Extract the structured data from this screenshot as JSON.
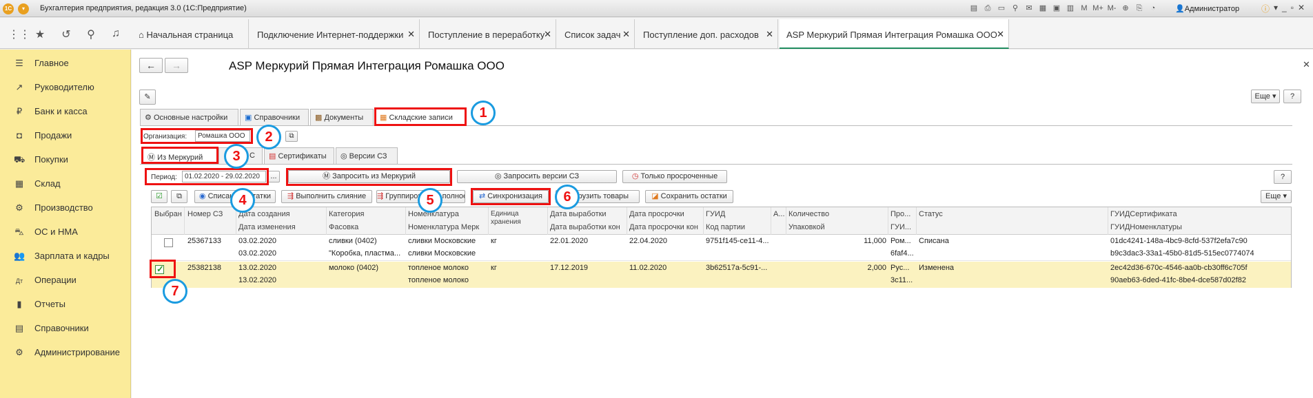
{
  "titlebar": {
    "logo": "1С",
    "title": "Бухгалтерия предприятия, редакция 3.0  (1С:Предприятие)",
    "icons": [
      "M",
      "M+",
      "M-"
    ],
    "user": "Администратор"
  },
  "tabs": [
    {
      "label": "Начальная страница",
      "home": true
    },
    {
      "label": "Подключение Интернет-поддержки",
      "closable": true
    },
    {
      "label": "Поступление в переработку",
      "closable": true
    },
    {
      "label": "Список задач",
      "closable": true
    },
    {
      "label": "Поступление доп. расходов",
      "closable": true
    },
    {
      "label": "ASP Меркурий Прямая Интеграция Ромашка ООО",
      "closable": true,
      "active": true
    }
  ],
  "sidebar": {
    "items": [
      {
        "label": "Главное",
        "icon": "menu-icon"
      },
      {
        "label": "Руководителю",
        "icon": "trend-icon"
      },
      {
        "label": "Банк и касса",
        "icon": "coin-icon"
      },
      {
        "label": "Продажи",
        "icon": "bag-icon"
      },
      {
        "label": "Покупки",
        "icon": "cart-icon"
      },
      {
        "label": "Склад",
        "icon": "warehouse-icon"
      },
      {
        "label": "Производство",
        "icon": "factory-icon"
      },
      {
        "label": "ОС и НМА",
        "icon": "truck-icon"
      },
      {
        "label": "Зарплата и кадры",
        "icon": "people-icon"
      },
      {
        "label": "Операции",
        "icon": "dt-kt-icon"
      },
      {
        "label": "Отчеты",
        "icon": "report-icon"
      },
      {
        "label": "Справочники",
        "icon": "book-icon"
      },
      {
        "label": "Администрирование",
        "icon": "gear-icon"
      }
    ]
  },
  "page": {
    "title": "ASP Меркурий Прямая Интеграция Ромашка ООО",
    "more_label": "Еще",
    "help_label": "?"
  },
  "top_tabs": [
    "Основные настройки",
    "Справочники",
    "Документы",
    "Складские записи"
  ],
  "org": {
    "label": "Организация:",
    "value": "Ромашка ООО"
  },
  "sub_tabs": [
    "Из Меркурий",
    "С",
    "Сертификаты",
    "Версии СЗ"
  ],
  "period": {
    "label": "Период:",
    "value": "01.02.2020 - 29.02.2020",
    "more": "..."
  },
  "buttons": {
    "request_mercury": "Запросить из Меркурий",
    "request_versions": "Запросить версии СЗ",
    "only_expired": "Только просроченные",
    "write_off": "Списание остатки",
    "merge": "Выполнить слияние",
    "group": "Группировка по полное",
    "sync": "Синхронизация",
    "load_goods": "Загрузить товары",
    "save_balances": "Сохранить остатки",
    "more": "Еще"
  },
  "callouts": [
    "1",
    "2",
    "3",
    "4",
    "5",
    "6",
    "7"
  ],
  "grid": {
    "headers_row1": [
      "Выбран",
      "Номер СЗ",
      "Дата создания",
      "Категория",
      "Номенклатура",
      "Единица хранения",
      "Дата выработки",
      "Дата просрочки",
      "ГУИД",
      "А...",
      "Количество",
      "Про...",
      "Статус",
      "ГУИДСертификата"
    ],
    "headers_row2": [
      "Дата изменения",
      "Фасовка",
      "Номенклатура Мерк",
      "Дата выработки кон",
      "Дата просрочки кон",
      "Код партии",
      "Упаковкой",
      "ГУИ...",
      "ГУИДНоменклатуры"
    ],
    "rows": [
      {
        "checked": false,
        "number": "25367133",
        "created": "03.02.2020",
        "changed": "03.02.2020",
        "category": "сливки (0402)",
        "packing": "\"Коробка, пластма...",
        "nomenclature": "сливки Московские",
        "nomenclature_m": "сливки Московские",
        "unit": "кг",
        "produced": "22.01.2020",
        "expires": "22.04.2020",
        "guid": "9751f145-ce11-4...",
        "qty": "11,000",
        "pro": "Ром...",
        "pro2": "6faf4...",
        "status": "Списана",
        "cert_guid": "01dc4241-148a-4bc9-8cfd-537f2efa7c90",
        "nom_guid": "b9c3dac3-33a1-45b0-81d5-515ec0774074"
      },
      {
        "checked": true,
        "number": "25382138",
        "created": "13.02.2020",
        "changed": "13.02.2020",
        "category": "молоко (0402)",
        "packing": "",
        "nomenclature": "топленое молоко",
        "nomenclature_m": "топленое молоко",
        "unit": "кг",
        "produced": "17.12.2019",
        "expires": "11.02.2020",
        "guid": "3b62517a-5c91-...",
        "qty": "2,000",
        "pro": "Рус...",
        "pro2": "3c11...",
        "status": "Изменена",
        "cert_guid": "2ec42d36-670c-4546-aa0b-cb30ff6c705f",
        "nom_guid": "90aeb63-6ded-41fc-8be4-dce587d02f82"
      }
    ]
  },
  "colors": {
    "accent": "#1f8c5f",
    "sidebar": "#fbeb9a",
    "highlight_row": "#fbf2c0",
    "annotation_red": "#e11111",
    "annotation_blue": "#1a9be0"
  }
}
